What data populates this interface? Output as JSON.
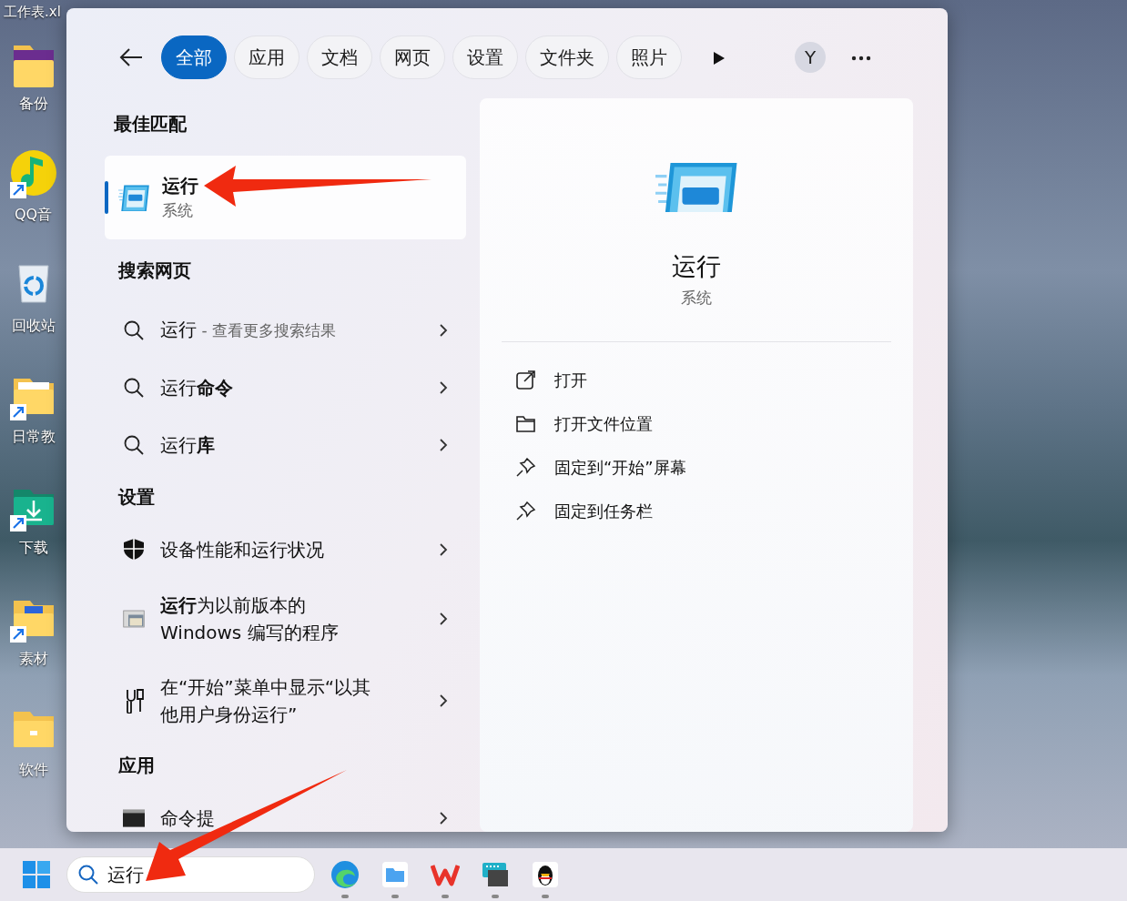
{
  "desktop": {
    "file_label": "工作表.xl",
    "icons": [
      {
        "kind": "folder-banner",
        "label": "备份",
        "shortcut": false
      },
      {
        "kind": "music",
        "label": "QQ音",
        "shortcut": true
      },
      {
        "kind": "recycle",
        "label": "回收站",
        "shortcut": false
      },
      {
        "kind": "folder-doc",
        "label": "日常教",
        "shortcut": true
      },
      {
        "kind": "download",
        "label": "下载",
        "shortcut": true
      },
      {
        "kind": "folder-word",
        "label": "素材",
        "shortcut": true
      },
      {
        "kind": "folder",
        "label": "软件",
        "shortcut": false
      }
    ]
  },
  "search_panel": {
    "tabs": [
      {
        "label": "全部",
        "selected": true
      },
      {
        "label": "应用",
        "selected": false
      },
      {
        "label": "文档",
        "selected": false
      },
      {
        "label": "网页",
        "selected": false
      },
      {
        "label": "设置",
        "selected": false
      },
      {
        "label": "文件夹",
        "selected": false
      },
      {
        "label": "照片",
        "selected": false
      }
    ],
    "account_initial": "Y",
    "best_match": {
      "heading": "最佳匹配",
      "title": "运行",
      "subtitle": "系统",
      "selected": true
    },
    "sections": [
      {
        "heading": "搜索网页",
        "items": [
          {
            "kind": "search",
            "text": "运行",
            "suffix": "- 查看更多搜索结果"
          },
          {
            "kind": "search",
            "text": "运行**命令**"
          },
          {
            "kind": "search",
            "text": "运行**库**"
          }
        ]
      },
      {
        "heading": "设置",
        "items": [
          {
            "kind": "shield",
            "text": "设备性能和运行状况"
          },
          {
            "kind": "compat",
            "text": "**运行**为以前版本的Windows 编写的程序"
          },
          {
            "kind": "tools",
            "text": "在“开始”菜单中显示“以其他用户身份运行”"
          }
        ]
      },
      {
        "heading": "应用",
        "items": [
          {
            "kind": "console",
            "text": "命令提"
          }
        ]
      }
    ],
    "preview": {
      "title": "运行",
      "subtitle": "系统",
      "actions": [
        {
          "kind": "open",
          "label": "打开"
        },
        {
          "kind": "folder",
          "label": "打开文件位置"
        },
        {
          "kind": "pin",
          "label": "固定到“开始”屏幕"
        },
        {
          "kind": "pin",
          "label": "固定到任务栏"
        }
      ]
    }
  },
  "taskbar": {
    "search": {
      "value": "运行"
    },
    "apps": [
      {
        "kind": "edge",
        "running": true
      },
      {
        "kind": "files",
        "running": true
      },
      {
        "kind": "wps",
        "running": true
      },
      {
        "kind": "keyboard",
        "running": true
      },
      {
        "kind": "penguin",
        "running": true
      }
    ]
  }
}
